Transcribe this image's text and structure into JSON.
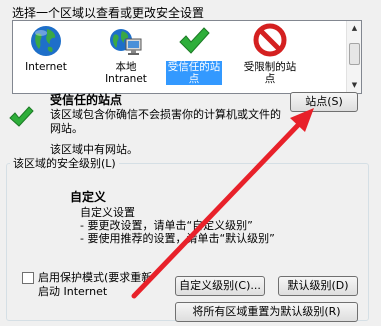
{
  "zones_prompt": "选择一个区域以查看或更改安全设置",
  "zones": [
    {
      "label": "Internet",
      "icon": "globe-icon"
    },
    {
      "label": "本地\nIntranet",
      "icon": "intranet-icon"
    },
    {
      "label": "受信任的站\n点",
      "icon": "checkmark-icon",
      "selected": true
    },
    {
      "label": "受限制的站\n点",
      "icon": "restricted-icon"
    }
  ],
  "selected_zone": {
    "title": "受信任的站点",
    "description": "该区域包含你确信不会损害你的计算机或文件的网站。",
    "sites_note": "该区域中有网站。",
    "sites_button": "站点(S)"
  },
  "security_level": {
    "group_label": "该区域的安全级别(L)",
    "level_title": "自定义",
    "description_lines": [
      "自定义设置",
      "- 要更改设置，请单击“自定义级别”",
      "- 要使用推荐的设置，请单击“默认级别”"
    ]
  },
  "protected_mode": {
    "label": "启用保护模式(要求重新\n启动 Internet",
    "checked": false
  },
  "buttons": {
    "custom_level": "自定义级别(C)...",
    "default_level": "默认级别(D)",
    "reset_all": "将所有区域重置为默认级别(R)"
  },
  "colors": {
    "selection": "#3399ff",
    "annotation_arrow": "#e8212a",
    "check_green": "#2eae3a"
  }
}
